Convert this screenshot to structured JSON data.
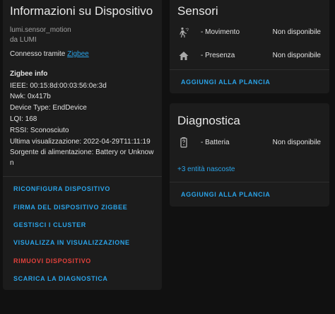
{
  "device_info": {
    "title": "Informazioni su Dispositivo",
    "model": "lumi.sensor_motion",
    "manufacturer": "da LUMI",
    "connected_via_prefix": "Connesso tramite",
    "connected_via_link": "Zigbee",
    "zigbee_heading": "Zigbee info",
    "ieee": "IEEE: 00:15:8d:00:03:56:0e:3d",
    "nwk": "Nwk: 0x417b",
    "device_type": "Device Type: EndDevice",
    "lqi": "LQI: 168",
    "rssi": "RSSI: Sconosciuto",
    "last_seen": "Ultima visualizzazione: 2022-04-29T11:11:19",
    "power_source_line1": "Sorgente di alimentazione: Battery or Unknow",
    "power_source_line2": "n",
    "actions": [
      "RICONFIGURA DISPOSITIVO",
      "FIRMA DEL DISPOSITIVO ZIGBEE",
      "GESTISCI I CLUSTER",
      "VISUALIZZA IN VISUALIZZAZIONE",
      "RIMUOVI DISPOSITIVO",
      "SCARICA LA DIAGNOSTICA"
    ]
  },
  "sensori": {
    "title": "Sensori",
    "rows": [
      {
        "icon": "motion-sensor-icon",
        "name": "- Movimento",
        "state": "Non disponibile"
      },
      {
        "icon": "home-icon",
        "name": "- Presenza",
        "state": "Non disponibile"
      }
    ],
    "add_button": "AGGIUNGI ALLA PLANCIA"
  },
  "diagnostica": {
    "title": "Diagnostica",
    "rows": [
      {
        "icon": "battery-unknown-icon",
        "name": "- Batteria",
        "state": "Non disponibile"
      }
    ],
    "hidden_entities": "+3 entità nascoste",
    "add_button": "AGGIUNGI ALLA PLANCIA"
  },
  "colors": {
    "background": "#111111",
    "card": "#1c1c1c",
    "accent": "#2aa3e8",
    "danger": "#e0413b"
  }
}
